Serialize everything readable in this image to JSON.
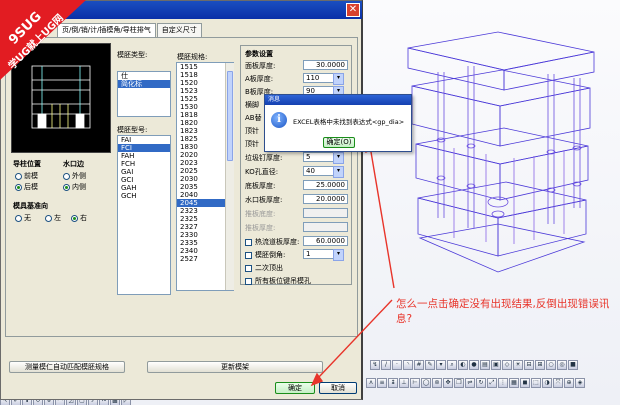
{
  "watermark": {
    "brand": "9SUG",
    "slogan": "学UG就上UG网"
  },
  "tabs": [
    "页/倒/销/计/插模角/导柱排气",
    "自定义尺寸"
  ],
  "preview_icon": "mold-preview",
  "guide_pos": {
    "label": "导柱位置",
    "opt1": "前模",
    "opt2": "后模",
    "selected": "后模"
  },
  "water_edge": {
    "label": "水口边",
    "opt1": "外侧",
    "opt2": "内侧",
    "selected": "内侧"
  },
  "datum": {
    "label": "模具基准向",
    "opt1": "无",
    "opt2": "左",
    "opt3": "右",
    "selected": "右"
  },
  "mold_type": {
    "label": "模胚类型:",
    "items": [
      "仕",
      "简化标"
    ],
    "selected": "简化标"
  },
  "mold_model": {
    "label": "模胚型号:",
    "items": [
      "FAI",
      "FCI",
      "FAH",
      "FCH",
      "GAI",
      "GCI",
      "GAH",
      "GCH"
    ],
    "selected": "FCI"
  },
  "mold_spec": {
    "label": "模胚规格:",
    "items": [
      "1515",
      "1518",
      "1520",
      "1523",
      "1525",
      "1530",
      "1818",
      "1820",
      "1823",
      "1825",
      "1830",
      "2020",
      "2023",
      "2025",
      "2030",
      "2035",
      "2040",
      "2045",
      "2323",
      "2325",
      "2327",
      "2330",
      "2335",
      "2340",
      "2527"
    ],
    "selected": "2045"
  },
  "params": {
    "header": "参数设置",
    "rows": [
      {
        "label": "面板厚度:",
        "value": "30.0000",
        "type": "text"
      },
      {
        "label": "A板厚度:",
        "value": "110",
        "type": "combo"
      },
      {
        "label": "B板厚度:",
        "value": "90",
        "type": "combo"
      },
      {
        "label": "横脚",
        "value": "",
        "type": "none"
      },
      {
        "label": "AB替",
        "value": "",
        "type": "none"
      },
      {
        "label": "顶针",
        "value": "",
        "type": "none"
      },
      {
        "label": "顶针",
        "value": "",
        "type": "none"
      },
      {
        "label": "垃圾钉厚度:",
        "value": "5",
        "type": "combo"
      },
      {
        "label": "KO孔直径:",
        "value": "40",
        "type": "combo"
      },
      {
        "label": "底板厚度:",
        "value": "25.0000",
        "type": "text"
      },
      {
        "label": "水口板厚度:",
        "value": "20.0000",
        "type": "text"
      },
      {
        "label": "推板底度:",
        "value": "",
        "type": "dis"
      },
      {
        "label": "推板厚度:",
        "value": "",
        "type": "dis"
      }
    ],
    "checks": [
      {
        "label": "热流道板厚度:",
        "value": "60.0000"
      },
      {
        "label": "模胚倒角:",
        "value": "1"
      },
      {
        "label": "二次顶出"
      },
      {
        "label": "所有板位键吊模孔"
      }
    ]
  },
  "bottom": {
    "auto_match": "测量模仁自动匹配模胚规格",
    "update": "更新模架",
    "ok": "确定",
    "cancel": "取消"
  },
  "message": {
    "title": "消息",
    "text": "EXCEL表格中未找到表达式<gp_dia>",
    "ok": "确定(O)"
  },
  "annotation": "怎么一点击确定没有出现结果,反倒出现错误讯息?",
  "colors": {
    "arrow": "#e8342a",
    "wire": "#4b39d8",
    "select": "#316ac5"
  }
}
